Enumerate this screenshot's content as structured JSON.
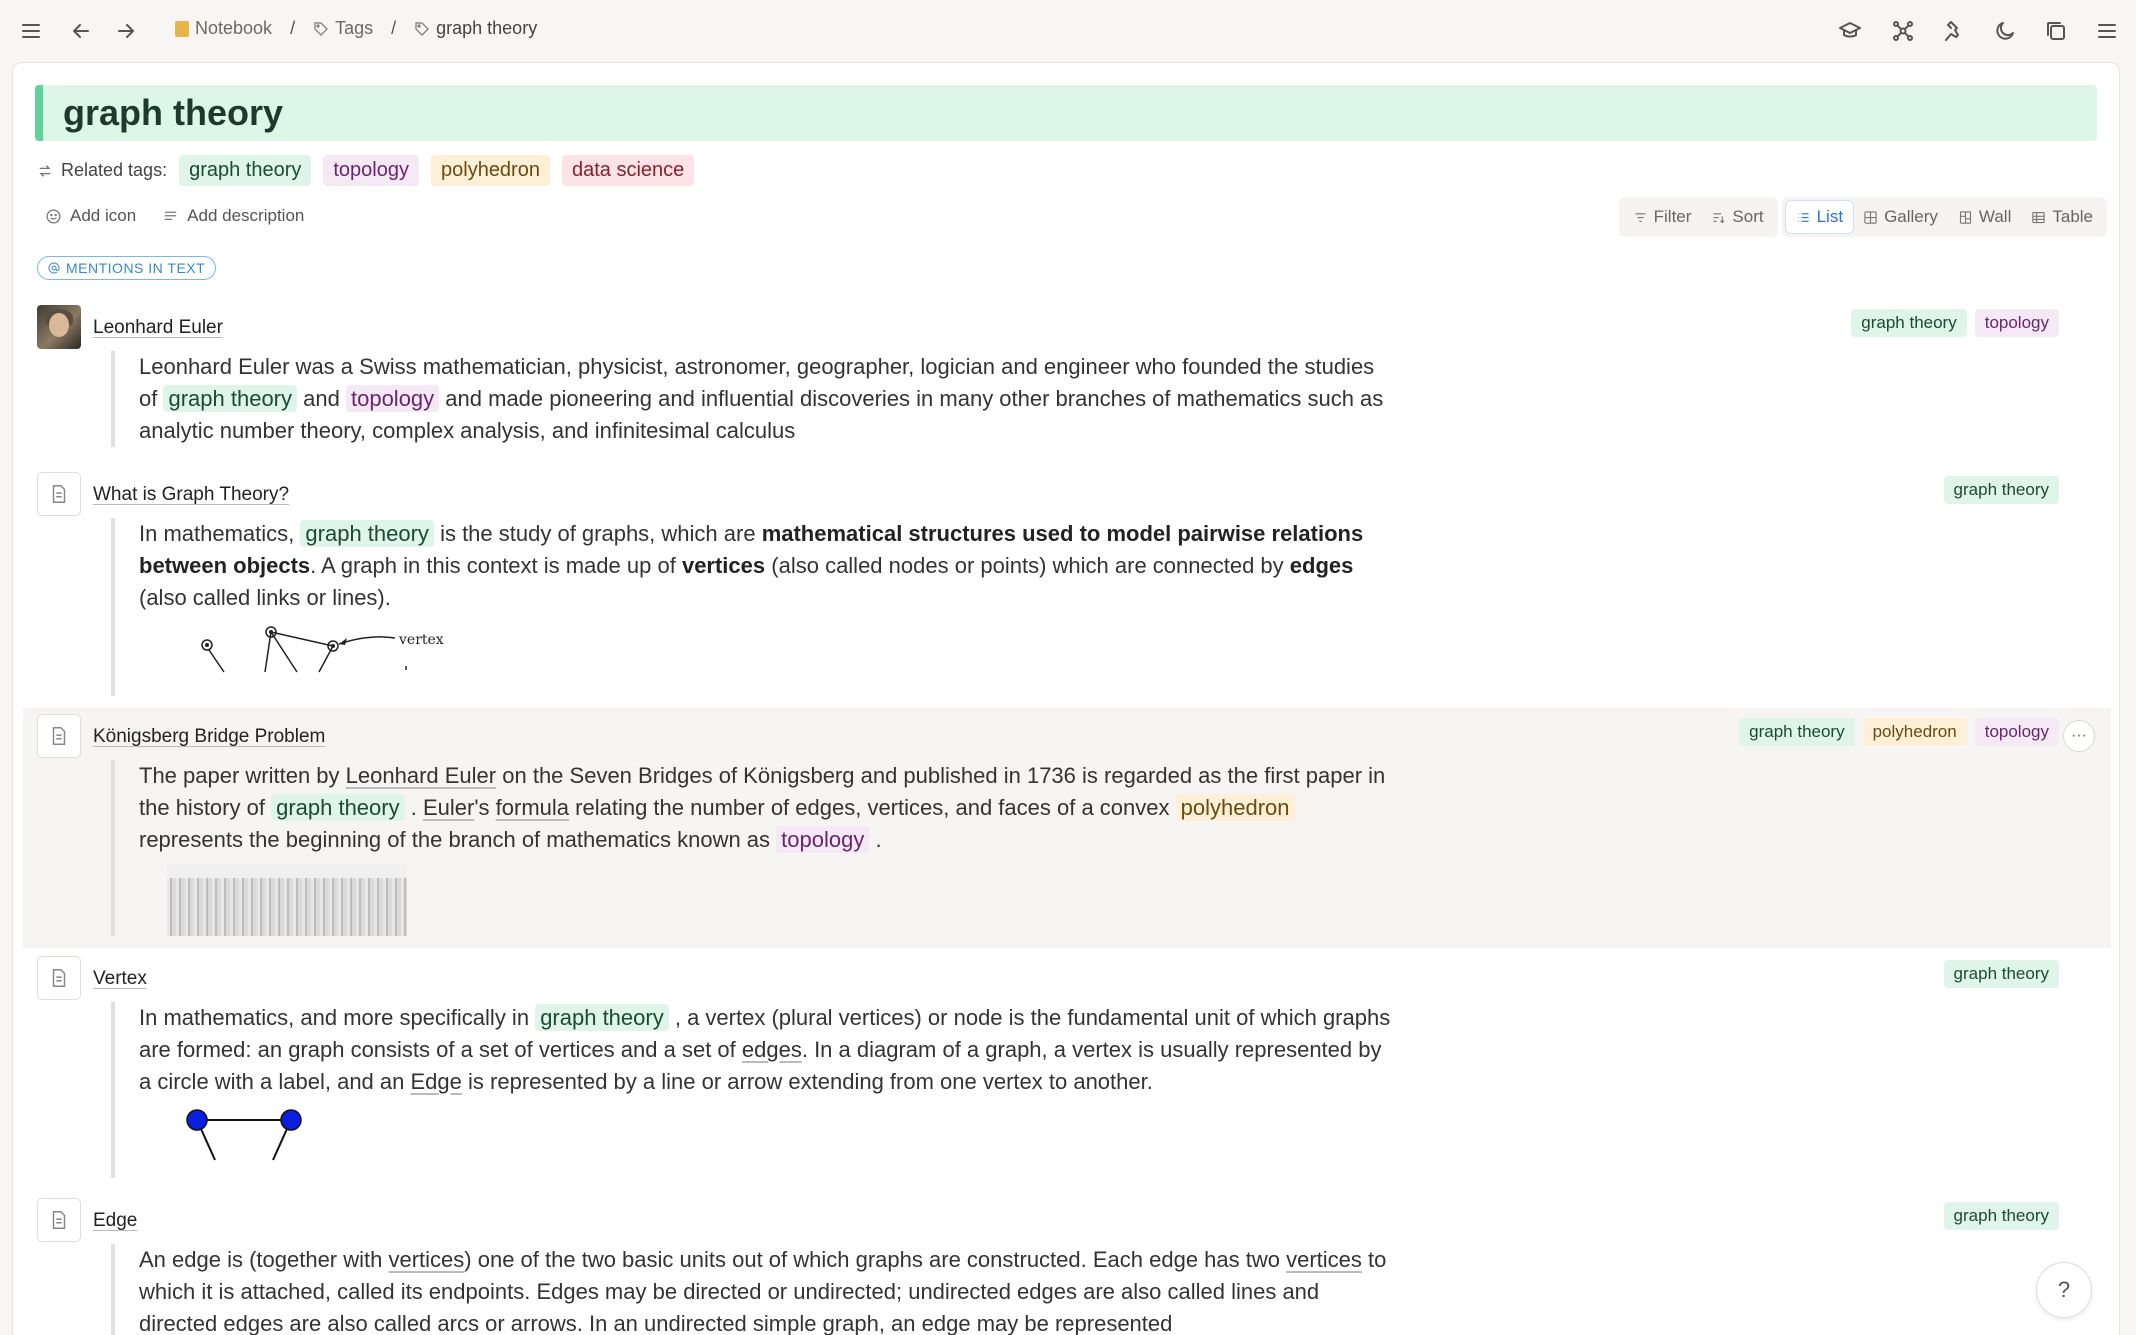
{
  "breadcrumb": {
    "notebook": "Notebook",
    "tags": "Tags",
    "current": "graph theory",
    "separator": "/"
  },
  "page": {
    "title": "graph theory"
  },
  "related": {
    "label": "Related tags:",
    "tags": [
      "graph theory",
      "topology",
      "polyhedron",
      "data science"
    ]
  },
  "actions": {
    "add_icon": "Add icon",
    "add_description": "Add description"
  },
  "views": {
    "filter": "Filter",
    "sort": "Sort",
    "list": "List",
    "gallery": "Gallery",
    "wall": "Wall",
    "table": "Table",
    "active": "List"
  },
  "section": {
    "mentions_label": "MENTIONS IN TEXT"
  },
  "entries": [
    {
      "title": "Leonhard Euler",
      "tags": [
        "graph theory",
        "topology"
      ],
      "text": {
        "a": "Leonhard Euler was a Swiss mathematician, physicist, astronomer, geographer, logician and engineer who founded the studies of",
        "tag1": "graph theory",
        "b": "and",
        "tag2": "topology",
        "c": "and made pioneering and influential discoveries in many other branches of mathematics such as analytic number theory, complex analysis, and infinitesimal calculus"
      }
    },
    {
      "title": "What is Graph Theory?",
      "tags": [
        "graph theory"
      ],
      "text": {
        "a": "In mathematics,",
        "tag1": "graph theory",
        "b": "is the study of graphs, which are",
        "bold1": "mathematical structures used to model pairwise relations between objects",
        "c": ". A graph in this context is made up of",
        "bold2": "vertices",
        "d": "(also called nodes or points) which are connected by",
        "bold3": "edges",
        "e": "(also called links or lines).",
        "figure_label": "vertex"
      }
    },
    {
      "title": "Königsberg Bridge Problem",
      "tags": [
        "graph theory",
        "polyhedron",
        "topology"
      ],
      "more": "···",
      "text": {
        "a": "The paper written by",
        "link1": "Leonhard Euler",
        "b": "on the Seven Bridges of Königsberg and published in 1736 is regarded as the first paper in the history of",
        "tag1": "graph theory",
        "c": ".",
        "link2": "Euler",
        "d": "'s",
        "link3": "formula",
        "e": "relating the number of edges, vertices, and faces of a convex",
        "tag2": "polyhedron",
        "f": "represents the beginning of the branch of mathematics known as",
        "tag3": "topology",
        "g": "."
      }
    },
    {
      "title": "Vertex",
      "tags": [
        "graph theory"
      ],
      "text": {
        "a": "In mathematics, and more specifically in",
        "tag1": "graph theory",
        "b": ", a vertex (plural vertices) or node is the fundamental unit of which graphs are formed: an graph consists of a set of vertices and a set of",
        "link1": "edges",
        "c": ". In a diagram of a graph, a vertex is usually represented by a circle with a label, and an",
        "link2": "Edge",
        "d": "is represented by a line or arrow extending from one vertex to another."
      }
    },
    {
      "title": "Edge",
      "tags": [
        "graph theory"
      ],
      "text": {
        "a": "An edge is (together with",
        "link1": "vertices",
        "b": ") one of the two basic units out of which graphs are constructed. Each edge has two",
        "link2": "vertices",
        "c": "to which it is attached, called its endpoints. Edges may be directed or undirected; undirected edges are also called lines and directed edges are also called arcs or arrows. In an undirected simple graph, an edge may be represented"
      }
    }
  ],
  "help": "?",
  "colors": {
    "tag_green_bg": "#dff5e9",
    "tag_purple_bg": "#f6e9f6",
    "tag_yellow_bg": "#fdf0d6",
    "tag_red_bg": "#fbe3e6",
    "title_bg": "#dcf6e8",
    "accent_blue": "#2d6fe0"
  }
}
